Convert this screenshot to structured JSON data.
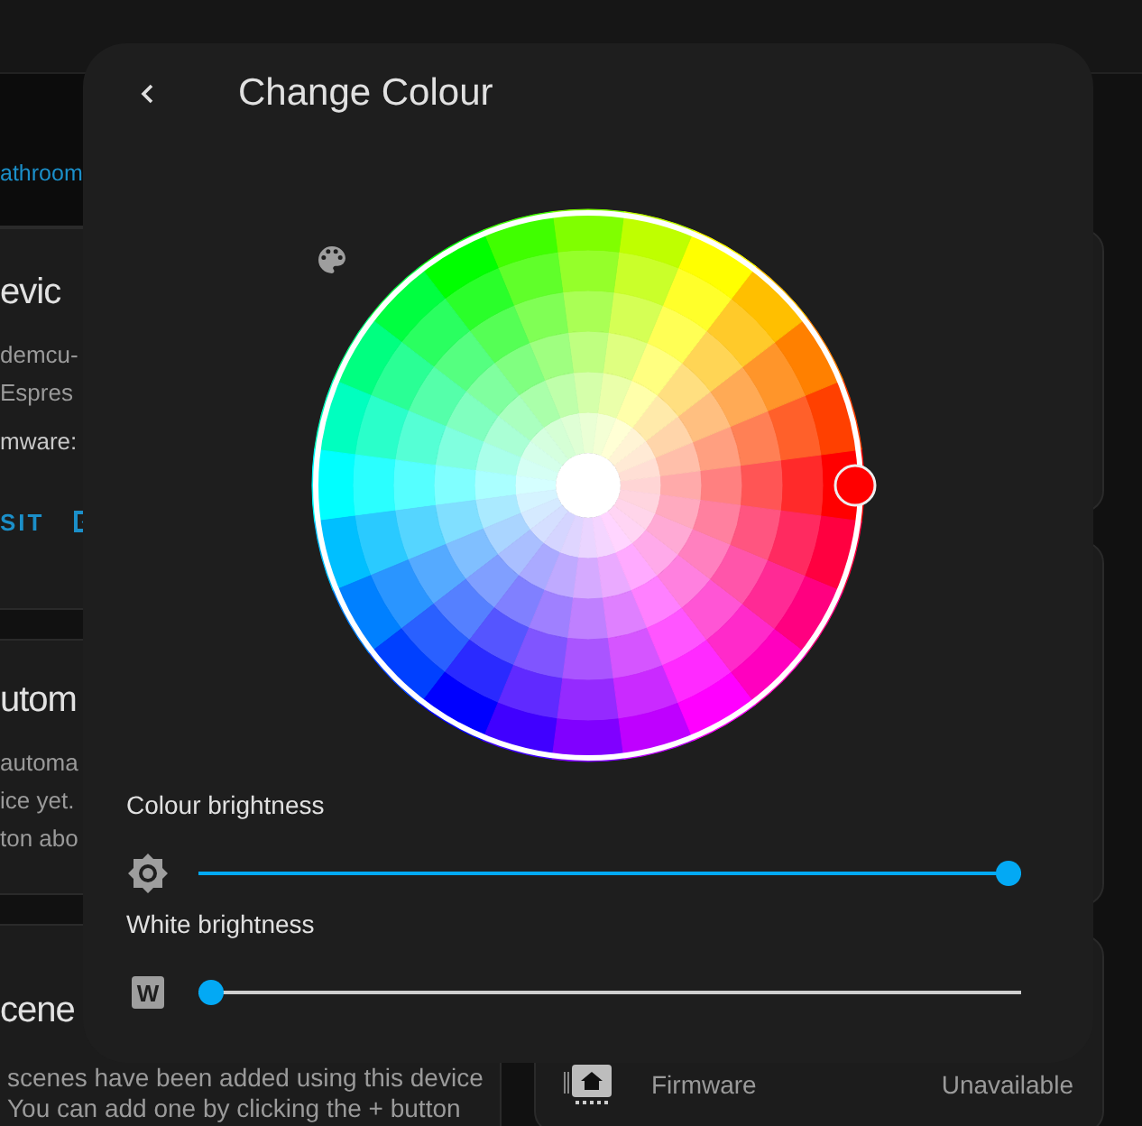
{
  "background": {
    "breadcrumb_link": "athroom",
    "device_card": {
      "heading": "evic",
      "lines": [
        "demcu-",
        "Espres"
      ],
      "firmware": "mware:",
      "visit_button": "SIT"
    },
    "automations_card": {
      "heading": "utom",
      "lines": [
        "automa",
        "ice yet.",
        "ton abo"
      ]
    },
    "scenes_card": {
      "heading": "cene",
      "lines": [
        "scenes have been added using this device",
        "You can add one by clicking the + button"
      ]
    },
    "firmware_row": {
      "label": "Firmware",
      "value": "Unavailable"
    }
  },
  "dialog": {
    "title": "Change Colour",
    "sliders": [
      {
        "label": "Colour brightness",
        "kind": "brightness",
        "level": 1
      },
      {
        "label": "White brightness",
        "kind": "white",
        "icon_text": "W",
        "level": 0
      }
    ]
  }
}
